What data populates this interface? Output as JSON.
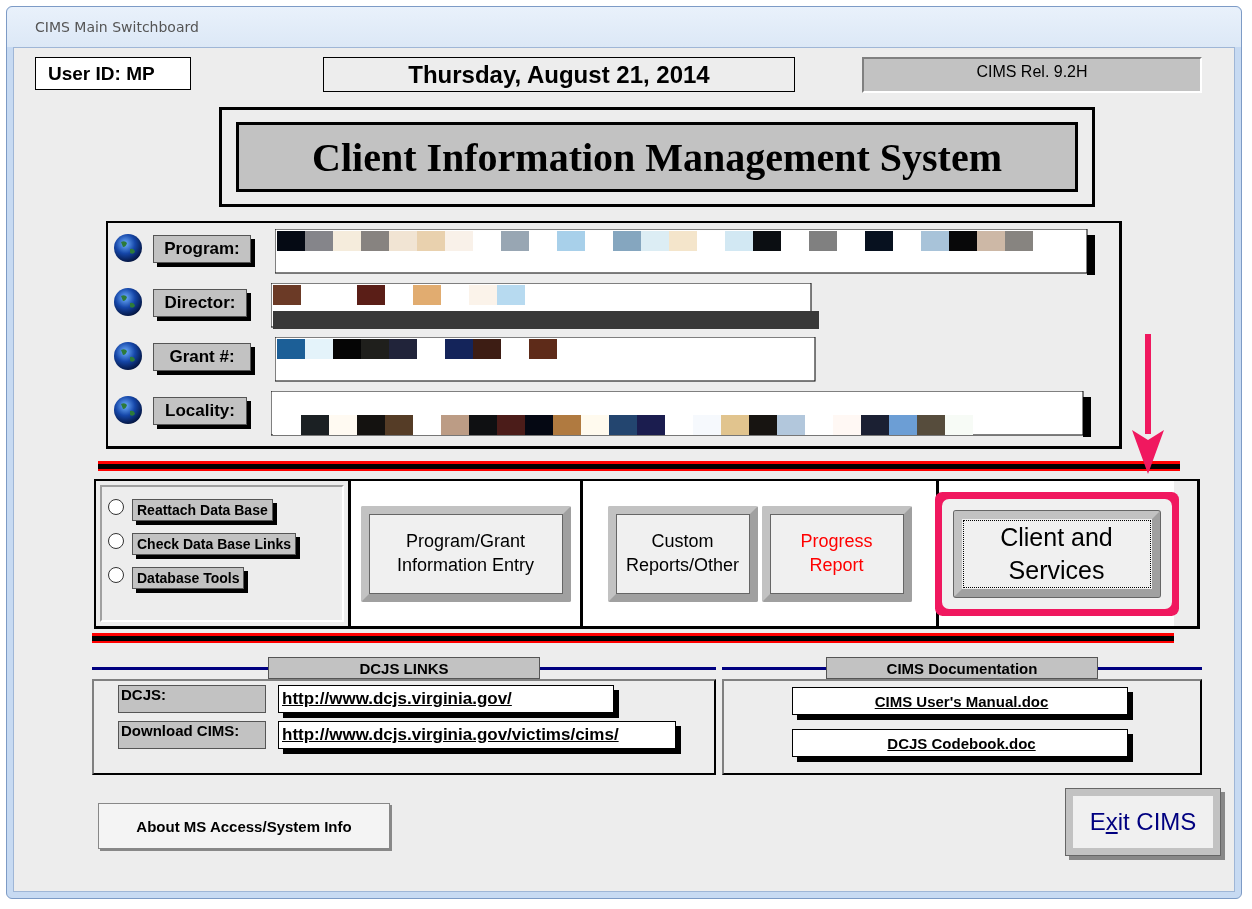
{
  "window": {
    "title": "CIMS Main Switchboard"
  },
  "header": {
    "user_id": "User ID: MP",
    "date": "Thursday, August 21, 2014",
    "release": "CIMS Rel. 9.2H"
  },
  "banner": {
    "title": "Client Information Management System"
  },
  "info_fields": [
    {
      "label": "Program:"
    },
    {
      "label": "Director:"
    },
    {
      "label": "Grant #:"
    },
    {
      "label": "Locality:"
    }
  ],
  "maintenance_options": [
    {
      "label": "Reattach Data Base",
      "selected": false
    },
    {
      "label": "Check Data Base Links",
      "selected": false
    },
    {
      "label": "Database Tools",
      "selected": false
    }
  ],
  "button_groups": [
    {
      "buttons": [
        {
          "label": "Program/Grant Information Entry",
          "color": "#000000",
          "highlighted": false
        }
      ]
    },
    {
      "buttons": [
        {
          "label": "Custom Reports/Other",
          "color": "#000000",
          "highlighted": false
        },
        {
          "label": "Progress Report",
          "color": "#ff0000",
          "highlighted": false
        }
      ]
    },
    {
      "buttons": [
        {
          "label": "Client and Services",
          "color": "#000000",
          "highlighted": true
        }
      ]
    }
  ],
  "dcjs_links": {
    "heading": "DCJS LINKS",
    "rows": [
      {
        "label": "DCJS:",
        "url": "http://www.dcjs.virginia.gov/"
      },
      {
        "label": "Download CIMS:",
        "url": "http://www.dcjs.virginia.gov/victims/cims/"
      }
    ]
  },
  "documentation": {
    "heading": "CIMS Documentation",
    "links": [
      "CIMS User's Manual.doc",
      "DCJS Codebook.doc"
    ]
  },
  "about_button": "About MS Access/System Info",
  "exit_button": {
    "label_parts": [
      {
        "text": "E",
        "underlined": false
      },
      {
        "text": "x",
        "underlined": true
      },
      {
        "text": "it CIMS",
        "underlined": false
      }
    ]
  }
}
